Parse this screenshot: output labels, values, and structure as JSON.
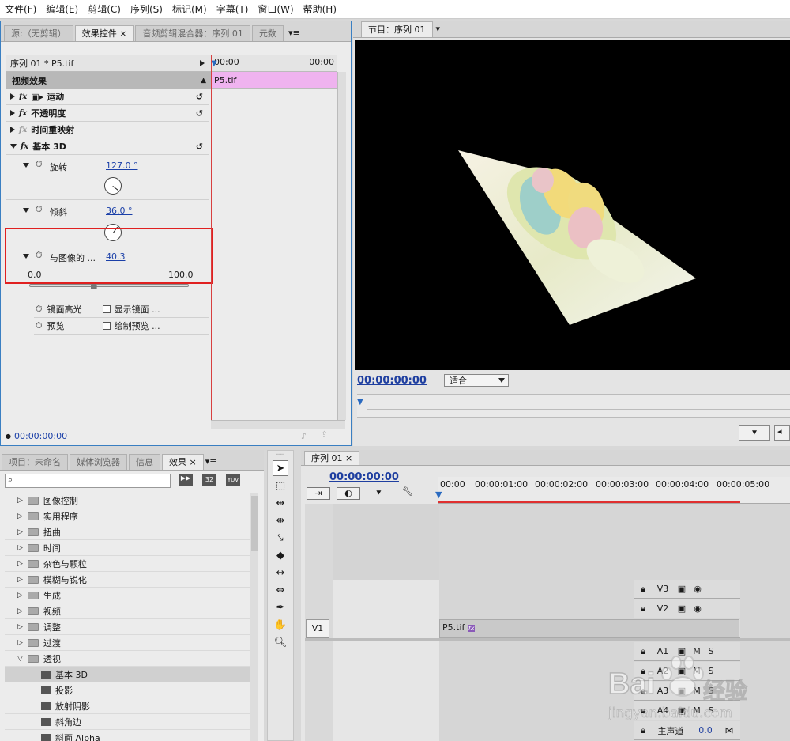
{
  "menu": [
    "文件(F)",
    "编辑(E)",
    "剪辑(C)",
    "序列(S)",
    "标记(M)",
    "字幕(T)",
    "窗口(W)",
    "帮助(H)"
  ],
  "source_panel": {
    "tabs": [
      "源:（无剪辑）",
      "效果控件",
      "音频剪辑混合器：序列 01",
      "元数"
    ],
    "clip_header": "序列 01 * P5.tif",
    "timeline_start": "00:00",
    "timeline_end": "00:00",
    "clip_bar": "P5.tif",
    "section": "视频效果",
    "effects": [
      "运动",
      "不透明度",
      "时间重映射",
      "基本 3D"
    ],
    "params": {
      "rotate_label": "旋转",
      "rotate_value": "127.0 °",
      "tilt_label": "倾斜",
      "tilt_value": "36.0 °",
      "distance_label": "与图像的 ...",
      "distance_value": "40.3",
      "slider_min": "0.0",
      "slider_max": "100.0",
      "slider_fraction": 0.403,
      "specular_label": "镜面高光",
      "specular_check": "显示镜面 ...",
      "preview_label": "预览",
      "preview_check": "绘制预览 ..."
    },
    "timecode": "00:00:00:00"
  },
  "program_panel": {
    "tab": "节目：序列 01",
    "timecode": "00:00:00:00",
    "fit": "适合"
  },
  "project_panel": {
    "tabs": [
      "项目：未命名",
      "媒体浏览器",
      "信息",
      "效果"
    ],
    "folders": [
      "图像控制",
      "实用程序",
      "扭曲",
      "时间",
      "杂色与颗粒",
      "模糊与锐化",
      "生成",
      "视频",
      "调整",
      "过渡",
      "透视"
    ],
    "sub_items": [
      "基本 3D",
      "投影",
      "放射阴影",
      "斜角边",
      "斜面 Alpha"
    ]
  },
  "timeline": {
    "tab": "序列 01",
    "timecode": "00:00:00:00",
    "ruler": [
      "00:00",
      "00:00:01:00",
      "00:00:02:00",
      "00:00:03:00",
      "00:00:04:00",
      "00:00:05:00"
    ],
    "video_tracks": [
      "V3",
      "V2",
      "V1"
    ],
    "audio_tracks": [
      "A1",
      "A2",
      "A3",
      "A4"
    ],
    "source_v1": "V1",
    "master": "主声道",
    "master_value": "0.0",
    "clip": "P5.tif",
    "clip_fx": "fx",
    "m": "M",
    "s": "S"
  },
  "watermark": {
    "brand": "Bai",
    "brand2": "经验",
    "url": "jingyan.baidu.com"
  }
}
